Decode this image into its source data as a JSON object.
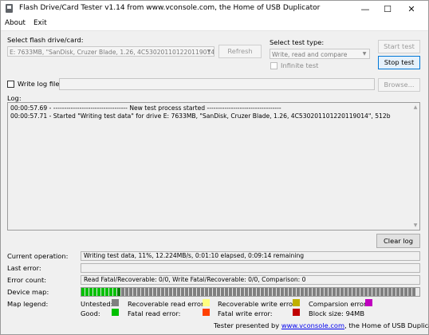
{
  "window": {
    "title": "Flash Drive/Card Tester v1.14 from www.vconsole.com, the Home of USB Duplicator",
    "minimize": "—",
    "maximize": "☐",
    "close": "✕"
  },
  "menu": {
    "about": "About",
    "exit": "Exit"
  },
  "drive": {
    "label": "Select flash drive/card:",
    "value": "E: 7633MB, \"SanDisk, Cruzer Blade, 1.26, 4C530201101220119014\"",
    "refresh": "Refresh"
  },
  "test": {
    "label": "Select test type:",
    "value": "Write, read and compare",
    "infinite": "Infinite test",
    "start": "Start test",
    "stop": "Stop test"
  },
  "logfile": {
    "label": "Write log file",
    "browse": "Browse..."
  },
  "log": {
    "label": "Log:",
    "lines": [
      "00:00:57.69 - ---------------------------------- New test process started ----------------------------------",
      "00:00:57.71 - Started \"Writing test data\" for drive E: 7633MB, \"SanDisk, Cruzer Blade, 1.26, 4C530201101220119014\", 512b"
    ],
    "clear": "Clear log"
  },
  "status": {
    "current_label": "Current operation:",
    "current_value": "Writing test data, 11%, 12.224MB/s, 0:01:10 elapsed, 0:09:14 remaining",
    "last_error_label": "Last error:",
    "last_error_value": "",
    "error_count_label": "Error count:",
    "error_count_value": "Read Fatal/Recoverable: 0/0, Write Fatal/Recoverable: 0/0, Comparison: 0",
    "device_map_label": "Device map:",
    "device_map_progress": 0.11,
    "map_legend_label": "Map legend:"
  },
  "legend": {
    "untested": "Untested:",
    "good": "Good:",
    "rec_read": "Recoverable read error:",
    "fatal_read": "Fatal read error:",
    "rec_write": "Recoverable write error:",
    "fatal_write": "Fatal write error:",
    "comparison": "Comparsion error:",
    "block_size": "Block size: 94MB"
  },
  "colors": {
    "untested": "#808080",
    "good": "#00c000",
    "rec_read": "#ffff80",
    "fatal_read": "#ff4000",
    "rec_write": "#c0b000",
    "fatal_write": "#c00000",
    "comparison": "#c000c0",
    "current_block": "#008000"
  },
  "footer": {
    "prefix": "Tester presented by ",
    "link": "www.vconsole.com",
    "suffix": ", the Home of USB Duplicator."
  }
}
